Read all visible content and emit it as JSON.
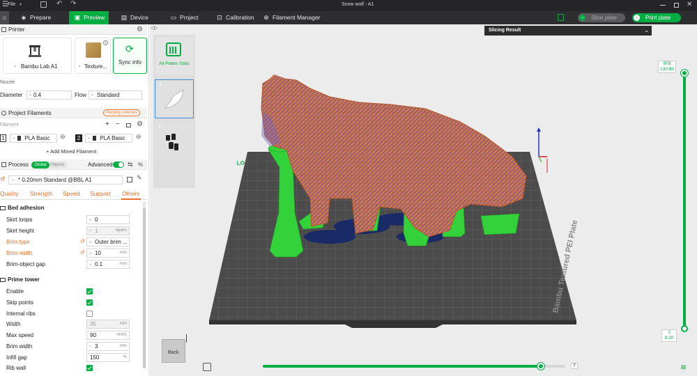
{
  "titlebar": {
    "file_menu": "File",
    "title": "Snow wolf - A1"
  },
  "tabs": {
    "prepare": "Prepare",
    "preview": "Preview",
    "device": "Device",
    "project": "Project",
    "calibration": "Calibration",
    "filament_manager": "Filament Manager"
  },
  "actions": {
    "slice_plate": "Slice plate",
    "print_plate": "Print plate"
  },
  "printer": {
    "section_title": "Printer",
    "name": "Bambu Lab A1",
    "plate": "Texture...",
    "sync": "Sync info",
    "nozzle_label": "Nozzle",
    "diameter_label": "Diameter",
    "diameter_value": "0.4",
    "flow_label": "Flow",
    "flow_value": "Standard"
  },
  "filaments": {
    "section_title": "Project Filaments",
    "purging_badge": "Purging volumes",
    "filament_label": "Filament",
    "items": [
      {
        "index": "1",
        "name": "PLA Basic",
        "color": "#f07a2e"
      },
      {
        "index": "2",
        "name": "PLA Basic",
        "color": "#3a5fcd"
      }
    ],
    "add_mixed": "+ Add Mixed Filament"
  },
  "process": {
    "section_title": "Process",
    "global_toggle": "Global",
    "objects_toggle": "Objects",
    "advanced_label": "Advanced",
    "advanced_on": true,
    "preset": "* 0.20mm Standard @BBL A1",
    "tabs": [
      "Quality",
      "Strength",
      "Speed",
      "Support",
      "Others"
    ],
    "active_tab": "Others"
  },
  "bed_adhesion": {
    "title": "Bed adhesion",
    "rows": [
      {
        "label": "Skirt loops",
        "value": "0",
        "unit": "",
        "modified": false
      },
      {
        "label": "Skirt height",
        "value": "1",
        "unit": "layers",
        "modified": false
      },
      {
        "label": "Brim type",
        "value": "Outer brim ...",
        "unit": "",
        "modified": true
      },
      {
        "label": "Brim width",
        "value": "10",
        "unit": "mm",
        "modified": true
      },
      {
        "label": "Brim-object gap",
        "value": "0.1",
        "unit": "mm",
        "modified": false
      }
    ]
  },
  "prime_tower": {
    "title": "Prime tower",
    "enable": "Enable",
    "enable_checked": true,
    "skip_points": "Skip points",
    "skip_checked": true,
    "internal_ribs": "Internal ribs",
    "ribs_checked": false,
    "width_label": "Width",
    "width_value": "35",
    "width_unit": "mm",
    "max_speed_label": "Max speed",
    "max_speed_value": "90",
    "max_speed_unit": "mm/s",
    "brim_width_label": "Brim width",
    "brim_width_value": "3",
    "brim_width_unit": "mm",
    "infill_gap_label": "Infill gap",
    "infill_gap_value": "150",
    "infill_gap_unit": "%",
    "rib_wall": "Rib wall",
    "rib_checked": true
  },
  "viewport": {
    "all_plates": "All Plates Stats",
    "plate_thumbs": [
      "1",
      "2"
    ],
    "slicing_result": "Slicing Result",
    "layer_top": "978",
    "height_top": "130.80",
    "layer_bottom": "1",
    "height_bottom": "0.20",
    "move_value": "7",
    "back_label": "Back",
    "plate_label": "Bambu Textured PEI Plate",
    "slider_fraction": 0.92
  },
  "colors": {
    "accent": "#00ae42",
    "modified": "#e8702a"
  }
}
